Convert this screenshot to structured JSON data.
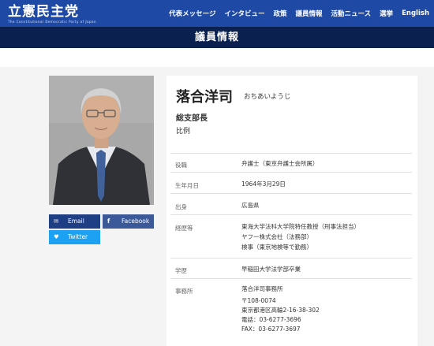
{
  "header": {
    "logo": "立憲民主党",
    "logo_sub": "The Constitutional Democratic Party of Japan",
    "nav": [
      "代表メッセージ",
      "インタビュー",
      "政策",
      "議員情報",
      "活動ニュース",
      "選挙",
      "English"
    ]
  },
  "page_title": "議員情報",
  "share": {
    "email": "Email",
    "facebook": "Facebook",
    "twitter": "Twitter"
  },
  "profile": {
    "name": "落合洋司",
    "kana": "おちあいようじ",
    "role": "総支部長",
    "district": "比例",
    "fields": [
      {
        "label": "役職",
        "lines": [
          "弁護士（東京弁護士会所属）"
        ]
      },
      {
        "label": "生年月日",
        "lines": [
          "1964年3月29日"
        ]
      },
      {
        "label": "出身",
        "lines": [
          "広島県"
        ]
      },
      {
        "label": "経歴等",
        "lines": [
          "東海大学法科大学院特任教授（刑事法担当）",
          "ヤフー株式会社（法務部）",
          "検事（東京地検等で勤務）"
        ]
      },
      {
        "label": "学歴",
        "lines": [
          "早稲田大学法学部卒業"
        ]
      },
      {
        "label": "事務所",
        "lines": [
          "落合洋司事務所",
          "〒108-0074",
          "東京都港区高輪2-16-38-302",
          "電話：03-6277-3696",
          "FAX：03-6277-3697"
        ]
      }
    ]
  },
  "colors": {
    "header": "#1e4aa6",
    "title_bar": "#0a2150",
    "email": "#1f3f84",
    "facebook": "#3b5998",
    "twitter": "#1da1f2"
  }
}
